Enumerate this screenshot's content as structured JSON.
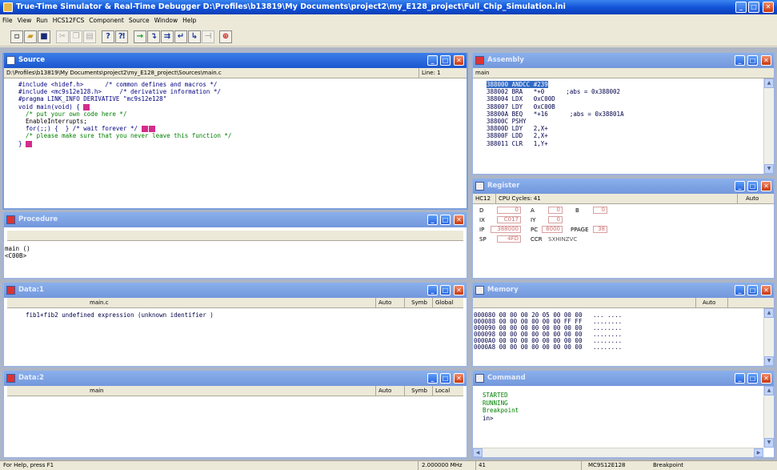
{
  "app_title": "True-Time Simulator & Real-Time Debugger   D:\\Profiles\\b13819\\My Documents\\project2\\my_E128_project\\Full_Chip_Simulation.ini",
  "menu": [
    "File",
    "View",
    "Run",
    "HCS12FCS",
    "Component",
    "Source",
    "Window",
    "Help"
  ],
  "source": {
    "title": "Source",
    "path": "D:\\Profiles\\b13819\\My Documents\\project2\\my_E128_project\\Sources\\main.c",
    "line": "Line: 1",
    "code": [
      "#include <hidef.h>      /* common defines and macros */",
      "#include <mc9s12e128.h>     /* derivative information */",
      "#pragma LINK_INFO DERIVATIVE \"mc9s12e128\"",
      "",
      "",
      "",
      "void main(void) {",
      "  /* put your own code here */",
      "  EnableInterrupts;",
      "",
      "  for(;;) {  } /* wait forever */",
      "  /* please make sure that you never leave this function */",
      "}"
    ]
  },
  "assembly": {
    "title": "Assembly",
    "header": "main",
    "lines": [
      "388000 ANDCC #239",
      "388002 BRA   *+0      ;abs = 0x388002",
      "388004 LDX   0xC00D",
      "388007 LDY   0xC00B",
      "38800A BEQ   *+16      ;abs = 0x38801A",
      "38800C PSHY",
      "38800D LDY   2,X+",
      "38800F LDD   2,X+",
      "388011 CLR   1,Y+"
    ]
  },
  "procedure": {
    "title": "Procedure",
    "lines": [
      "main ()",
      "<C00B>"
    ]
  },
  "register": {
    "title": "Register",
    "cpu": "HC12",
    "cycles": "CPU Cycles: 41",
    "mode": "Auto",
    "regs": {
      "D": "0",
      "A": "0",
      "B": "0",
      "IX": "C017",
      "IY": "0",
      "IP": "388000",
      "PC": "8000",
      "PPAGE": "38",
      "SP": "4FD",
      "CCR": "SXHINZVC"
    }
  },
  "data1": {
    "title": "Data:1",
    "file": "main.c",
    "cols": [
      "Auto",
      "Symb",
      "Global"
    ],
    "message": "fib1+fib2 undefined expression (unknown identifier )"
  },
  "memory": {
    "title": "Memory",
    "mode": "Auto",
    "rows": [
      "000080 00 00 00 20 05 00 00 00   ... ....",
      "000088 00 00 00 00 00 00 FF FF   ........",
      "000090 00 00 00 00 00 00 00 00   ........",
      "000098 00 00 00 00 00 00 00 00   ........",
      "0000A0 00 00 00 00 00 00 00 00   ........",
      "0000A8 00 00 00 00 00 00 00 00   ........"
    ]
  },
  "data2": {
    "title": "Data:2",
    "file": "main",
    "cols": [
      "Auto",
      "Symb",
      "Local"
    ]
  },
  "command": {
    "title": "Command",
    "lines": [
      "STARTED",
      "RUNNING",
      "Breakpoint",
      "",
      "in>"
    ]
  },
  "status": {
    "help": "For Help, press F1",
    "freq": "2.000000 MHz",
    "cycles": "41",
    "chip": "MC9S12E128",
    "state": "Breakpoint"
  },
  "colors": {
    "active_title": "#1b57cf",
    "inactive_title": "#7397dc",
    "code_keyword": "#000080",
    "code_comment": "#008000",
    "command_text": "#008000"
  }
}
